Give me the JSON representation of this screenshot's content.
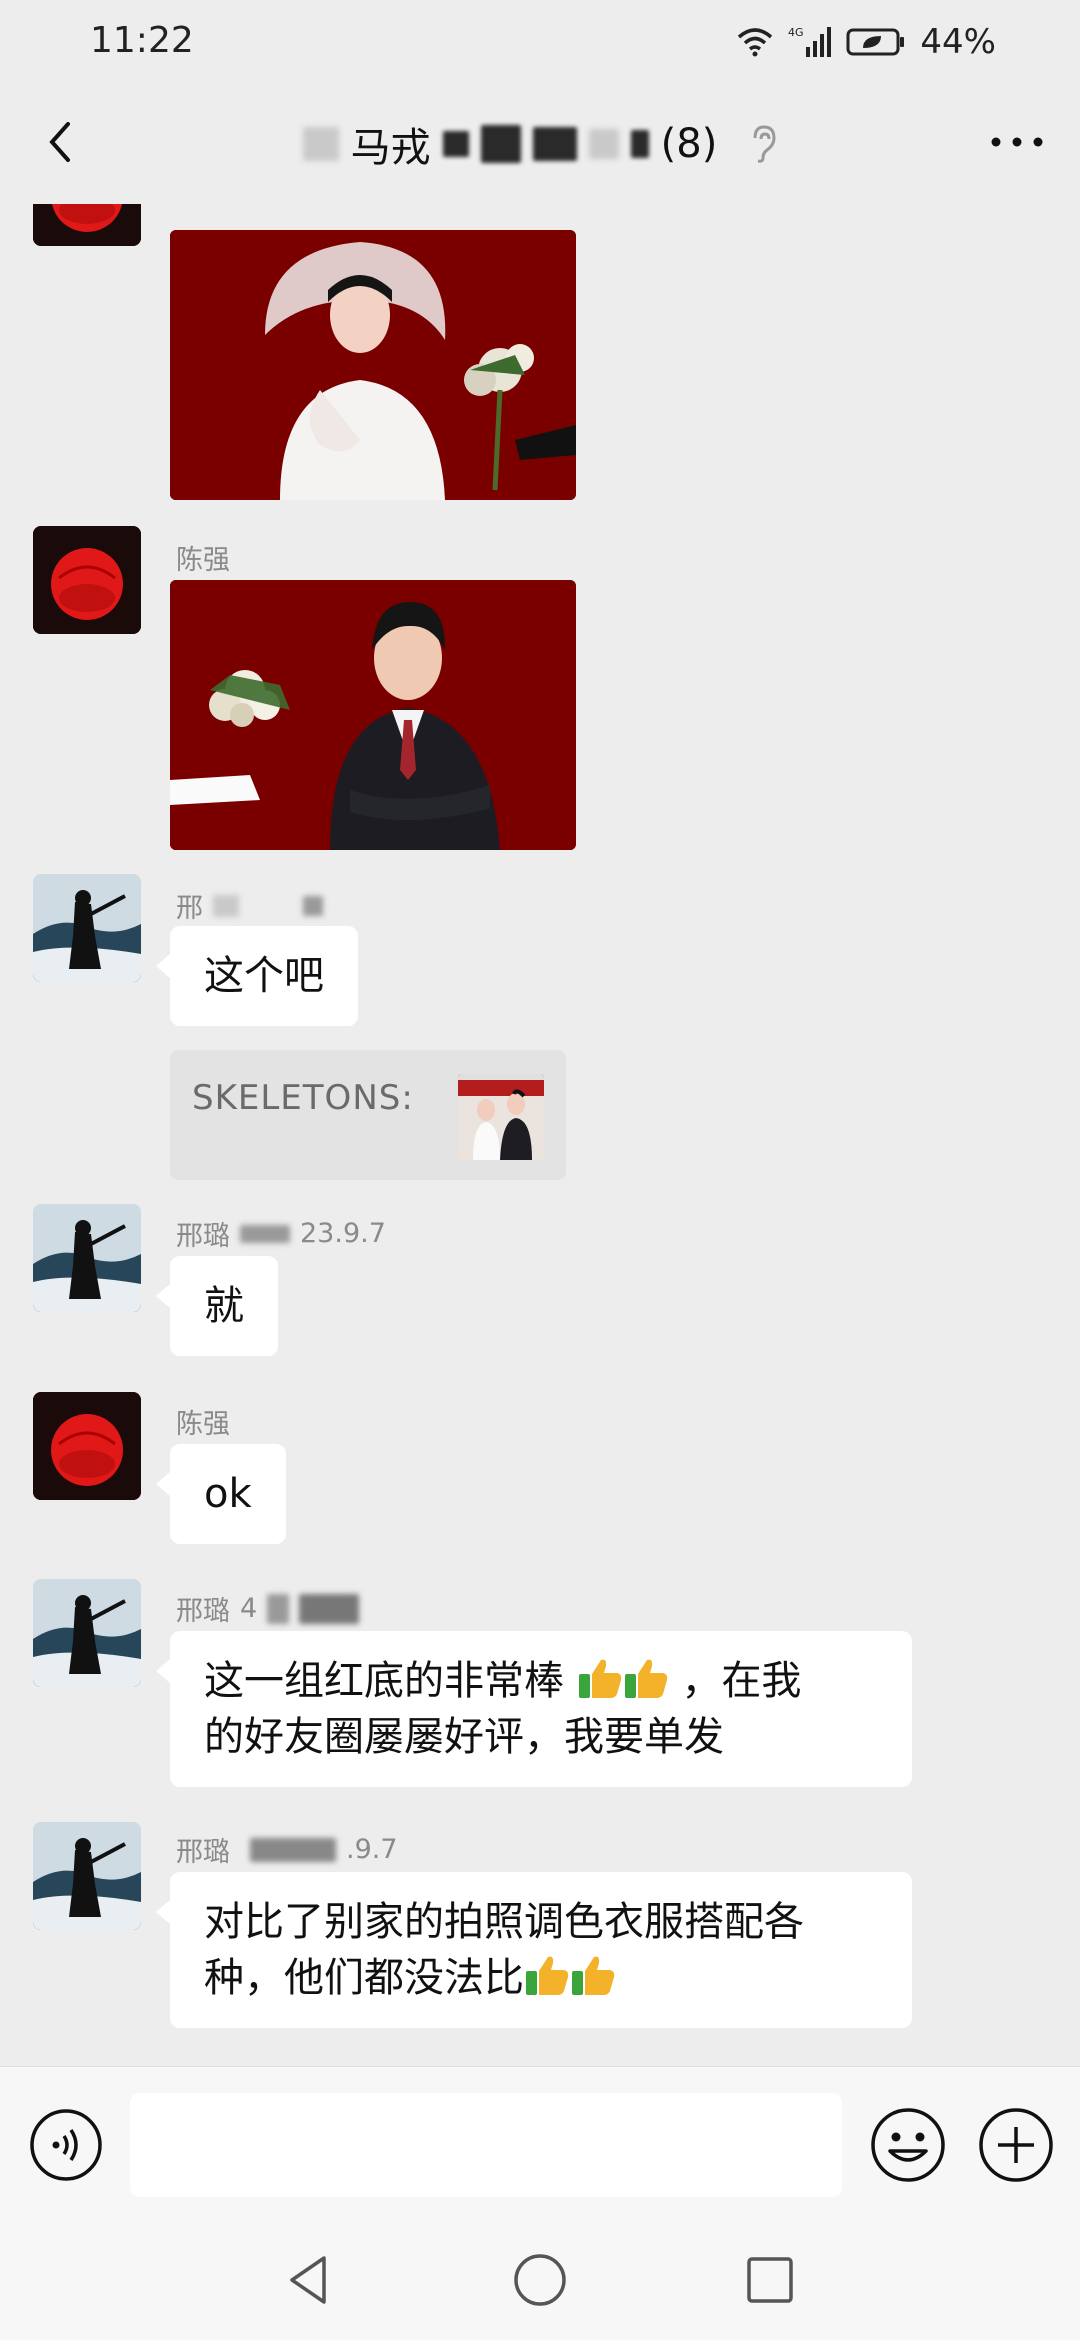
{
  "status_bar": {
    "time": "11:22",
    "network": "4G",
    "battery": "44%"
  },
  "header": {
    "title_visible": "马戎",
    "member_count": "(8)"
  },
  "messages": [
    {
      "type": "image",
      "sender": "陈强",
      "avatar": "red-avatar",
      "image": "bride-photo-red-background"
    },
    {
      "type": "image",
      "sender": "陈强",
      "avatar": "red-avatar",
      "image": "groom-photo-red-background"
    },
    {
      "type": "text",
      "sender": "邢",
      "avatar": "scene-avatar",
      "text": "这个吧",
      "quote": {
        "text": "SKELETONS:",
        "thumb": "couple-photo-thumbnail"
      }
    },
    {
      "type": "text",
      "sender": "邢璐",
      "sender_suffix": "23.9.7",
      "avatar": "scene-avatar",
      "text": "就"
    },
    {
      "type": "text",
      "sender": "陈强",
      "avatar": "red-avatar",
      "text": "ok"
    },
    {
      "type": "text",
      "sender": "邢璐",
      "sender_suffix": "4",
      "avatar": "scene-avatar",
      "line1a": "这一组红底的非常棒",
      "line1b": "，在我",
      "line2": "的好友圈屡屡好评，我要单发"
    },
    {
      "type": "text",
      "sender": "邢璐",
      "sender_suffix": ".9.7",
      "avatar": "scene-avatar",
      "line1": "对比了别家的拍照调色衣服搭配各",
      "line2": "种，他们都没法比"
    }
  ],
  "input": {
    "placeholder": ""
  },
  "icons": {
    "back": "back-chevron-icon",
    "more": "more-dots-icon",
    "earpiece": "ear-icon",
    "voice": "voice-input-icon",
    "emoji": "emoji-icon",
    "plus": "plus-icon",
    "thumbs_up": "thumbs-up-emoji"
  },
  "colors": {
    "bubble": "#ffffff",
    "background": "#ededed",
    "photo_red": "#7a0000"
  }
}
